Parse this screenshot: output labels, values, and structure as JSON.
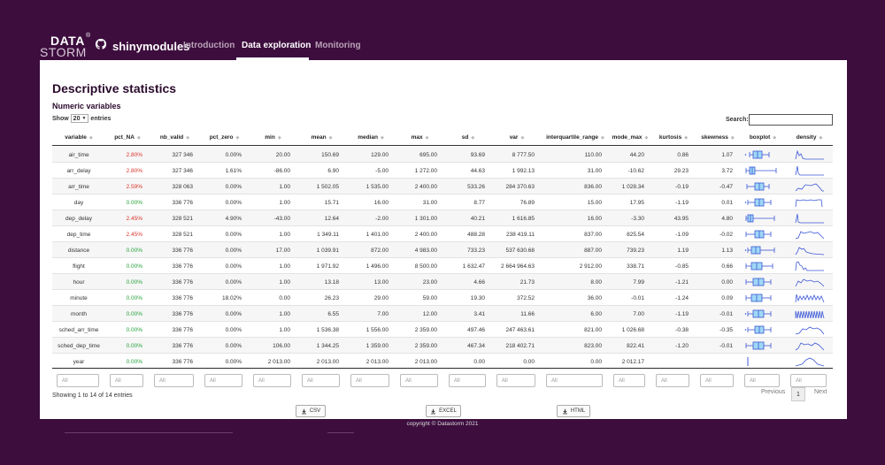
{
  "app": {
    "logo_top": "DATA",
    "logo_bottom": "STORM",
    "logo_mark": "®",
    "name": "shinymodules"
  },
  "nav": {
    "tabs": [
      {
        "label": "Introduction",
        "active": false
      },
      {
        "label": "Data exploration",
        "active": true
      },
      {
        "label": "Monitoring",
        "active": false
      }
    ]
  },
  "page": {
    "title": "Descriptive statistics",
    "section": "Numeric variables"
  },
  "controls": {
    "show_label": "Show",
    "show_value": "20",
    "entries_label": "entries",
    "search_label": "Search:",
    "search_value": ""
  },
  "table": {
    "columns": [
      "variable",
      "pct_NA",
      "nb_valid",
      "pct_zero",
      "min",
      "mean",
      "median",
      "max",
      "sd",
      "var",
      "interquartile_range",
      "mode_max",
      "kurtosis",
      "skewness",
      "boxplot",
      "density"
    ],
    "rows": [
      {
        "variable": "air_time",
        "pct_NA": "2.80%",
        "na_status": "red",
        "nb_valid": "327 346",
        "pct_zero": "0.00%",
        "min": "20.00",
        "mean": "150.69",
        "median": "129.00",
        "max": "695.00",
        "sd": "93.69",
        "var": "8 777.50",
        "iqr": "110.00",
        "mode_max": "44.20",
        "kurtosis": "0.86",
        "skewness": "1.07"
      },
      {
        "variable": "arr_delay",
        "pct_NA": "2.80%",
        "na_status": "red",
        "nb_valid": "327 346",
        "pct_zero": "1.61%",
        "min": "-86.00",
        "mean": "6.90",
        "median": "-5.00",
        "max": "1 272.00",
        "sd": "44.63",
        "var": "1 992.13",
        "iqr": "31.00",
        "mode_max": "-10.62",
        "kurtosis": "29.23",
        "skewness": "3.72"
      },
      {
        "variable": "arr_time",
        "pct_NA": "2.59%",
        "na_status": "red",
        "nb_valid": "328 063",
        "pct_zero": "0.00%",
        "min": "1.00",
        "mean": "1 502.05",
        "median": "1 535.00",
        "max": "2 400.00",
        "sd": "533.26",
        "var": "284 370.63",
        "iqr": "836.00",
        "mode_max": "1 028.34",
        "kurtosis": "-0.19",
        "skewness": "-0.47"
      },
      {
        "variable": "day",
        "pct_NA": "0.00%",
        "na_status": "green",
        "nb_valid": "336 776",
        "pct_zero": "0.00%",
        "min": "1.00",
        "mean": "15.71",
        "median": "16.00",
        "max": "31.00",
        "sd": "8.77",
        "var": "76.89",
        "iqr": "15.00",
        "mode_max": "17.95",
        "kurtosis": "-1.19",
        "skewness": "0.01"
      },
      {
        "variable": "dep_delay",
        "pct_NA": "2.45%",
        "na_status": "red",
        "nb_valid": "328 521",
        "pct_zero": "4.90%",
        "min": "-43.00",
        "mean": "12.64",
        "median": "-2.00",
        "max": "1 301.00",
        "sd": "40.21",
        "var": "1 616.85",
        "iqr": "16.00",
        "mode_max": "-3.30",
        "kurtosis": "43.95",
        "skewness": "4.80"
      },
      {
        "variable": "dep_time",
        "pct_NA": "2.45%",
        "na_status": "red",
        "nb_valid": "328 521",
        "pct_zero": "0.00%",
        "min": "1.00",
        "mean": "1 349.11",
        "median": "1 401.00",
        "max": "2 400.00",
        "sd": "488.28",
        "var": "238 419.11",
        "iqr": "837.00",
        "mode_max": "825.54",
        "kurtosis": "-1.09",
        "skewness": "-0.02"
      },
      {
        "variable": "distance",
        "pct_NA": "0.00%",
        "na_status": "green",
        "nb_valid": "336 776",
        "pct_zero": "0.00%",
        "min": "17.00",
        "mean": "1 039.91",
        "median": "872.00",
        "max": "4 983.00",
        "sd": "733.23",
        "var": "537 630.68",
        "iqr": "887.00",
        "mode_max": "739.23",
        "kurtosis": "1.19",
        "skewness": "1.13"
      },
      {
        "variable": "flight",
        "pct_NA": "0.00%",
        "na_status": "green",
        "nb_valid": "336 776",
        "pct_zero": "0.00%",
        "min": "1.00",
        "mean": "1 971.92",
        "median": "1 496.00",
        "max": "8 500.00",
        "sd": "1 632.47",
        "var": "2 664 964.63",
        "iqr": "2 912.00",
        "mode_max": "338.71",
        "kurtosis": "-0.85",
        "skewness": "0.66"
      },
      {
        "variable": "hour",
        "pct_NA": "0.00%",
        "na_status": "green",
        "nb_valid": "336 776",
        "pct_zero": "0.00%",
        "min": "1.00",
        "mean": "13.18",
        "median": "13.00",
        "max": "23.00",
        "sd": "4.66",
        "var": "21.73",
        "iqr": "8.00",
        "mode_max": "7.99",
        "kurtosis": "-1.21",
        "skewness": "0.00"
      },
      {
        "variable": "minute",
        "pct_NA": "0.00%",
        "na_status": "green",
        "nb_valid": "336 776",
        "pct_zero": "18.02%",
        "min": "0.00",
        "mean": "26.23",
        "median": "29.00",
        "max": "59.00",
        "sd": "19.30",
        "var": "372.52",
        "iqr": "36.00",
        "mode_max": "-0.01",
        "kurtosis": "-1.24",
        "skewness": "0.09"
      },
      {
        "variable": "month",
        "pct_NA": "0.00%",
        "na_status": "green",
        "nb_valid": "336 776",
        "pct_zero": "0.00%",
        "min": "1.00",
        "mean": "6.55",
        "median": "7.00",
        "max": "12.00",
        "sd": "3.41",
        "var": "11.66",
        "iqr": "6.00",
        "mode_max": "7.00",
        "kurtosis": "-1.19",
        "skewness": "-0.01"
      },
      {
        "variable": "sched_arr_time",
        "pct_NA": "0.00%",
        "na_status": "green",
        "nb_valid": "336 776",
        "pct_zero": "0.00%",
        "min": "1.00",
        "mean": "1 536.38",
        "median": "1 556.00",
        "max": "2 359.00",
        "sd": "497.46",
        "var": "247 463.61",
        "iqr": "821.00",
        "mode_max": "1 026.68",
        "kurtosis": "-0.38",
        "skewness": "-0.35"
      },
      {
        "variable": "sched_dep_time",
        "pct_NA": "0.00%",
        "na_status": "green",
        "nb_valid": "336 776",
        "pct_zero": "0.00%",
        "min": "106.00",
        "mean": "1 344.25",
        "median": "1 359.00",
        "max": "2 359.00",
        "sd": "467.34",
        "var": "218 402.71",
        "iqr": "823.00",
        "mode_max": "822.41",
        "kurtosis": "-1.20",
        "skewness": "-0.01"
      },
      {
        "variable": "year",
        "pct_NA": "0.00%",
        "na_status": "green",
        "nb_valid": "336 776",
        "pct_zero": "0.00%",
        "min": "2 013.00",
        "mean": "2 013.00",
        "median": "2 013.00",
        "max": "2 013.00",
        "sd": "0.00",
        "var": "0.00",
        "iqr": "0.00",
        "mode_max": "2 012.17",
        "kurtosis": "",
        "skewness": ""
      }
    ],
    "filter_placeholder": "All",
    "info": "Showing 1 to 14 of 14 entries",
    "pager_prev": "Previous",
    "pager_current": "1",
    "pager_next": "Next"
  },
  "downloads": {
    "csv": "CSV",
    "excel": "EXCEL",
    "html": "HTML"
  },
  "footer": {
    "copyright": "copyright © Datastorm 2021"
  },
  "colors": {
    "brand": "#3d0d3e",
    "na_red": "#d9332b",
    "na_green": "#26a33a",
    "spark": "#3b57d6",
    "box_fill": "#9fd8f5"
  }
}
